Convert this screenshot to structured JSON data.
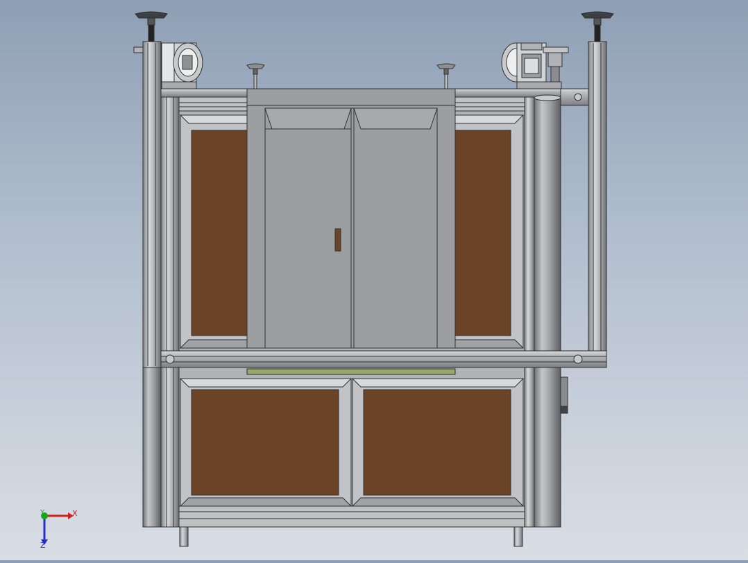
{
  "viewport": {
    "background_top": "#8e9fb5",
    "background_bottom": "#d9dee5"
  },
  "triad": {
    "x_label": "X",
    "y_label": "Y",
    "z_label": "Z",
    "x_color": "#d12020",
    "y_color": "#19a619",
    "z_color": "#2430c8"
  },
  "model": {
    "frame_color": "#a9abae",
    "frame_edge": "#3b3b3b",
    "panel_brown": "#6b4428",
    "glass_gray": "#9c9c9c",
    "rail_green": "#9aa66a"
  }
}
